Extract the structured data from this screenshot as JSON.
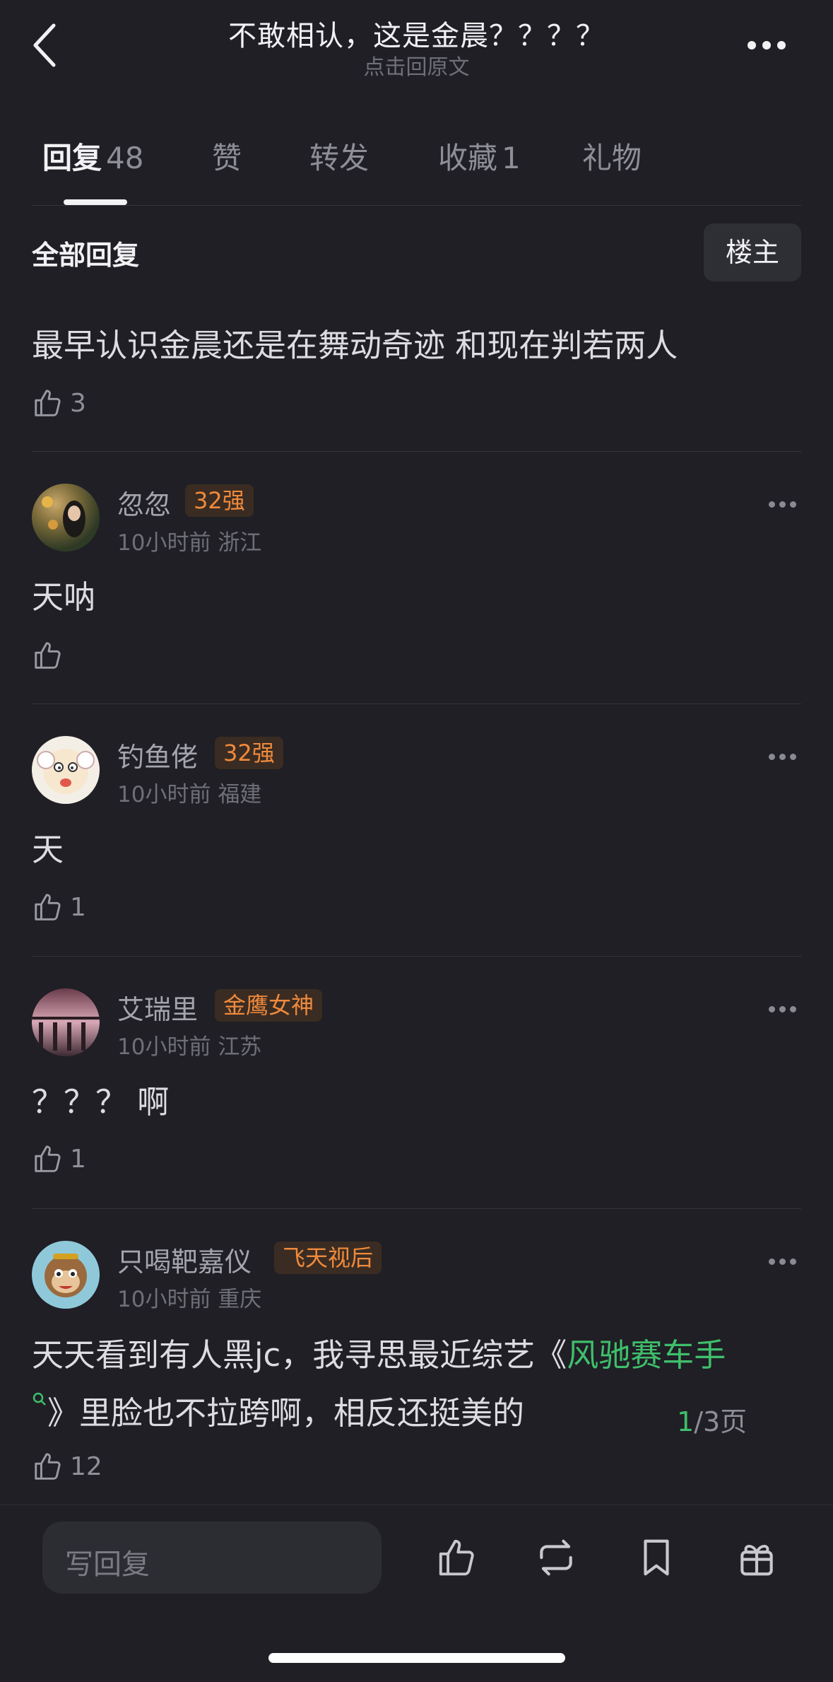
{
  "header": {
    "title": "不敢相认，这是金晨？？？？",
    "subtitle": "点击回原文"
  },
  "tabs": [
    {
      "label": "回复",
      "count": "48"
    },
    {
      "label": "赞",
      "count": ""
    },
    {
      "label": "转发",
      "count": ""
    },
    {
      "label": "收藏",
      "count": "1"
    },
    {
      "label": "礼物",
      "count": ""
    }
  ],
  "filter": {
    "all_label": "全部回复",
    "owner_button": "楼主"
  },
  "top_reply": {
    "text": "最早认识金晨还是在舞动奇迹 和现在判若两人",
    "likes": "3"
  },
  "comments": [
    {
      "name": "忽忽",
      "badge": "32强",
      "time": "10小时前",
      "location": "浙江",
      "text": "天呐",
      "likes": ""
    },
    {
      "name": "钓鱼佬",
      "badge": "32强",
      "time": "10小时前",
      "location": "福建",
      "text": "天",
      "likes": "1"
    },
    {
      "name": "艾瑞里",
      "badge": "金鹰女神",
      "time": "10小时前",
      "location": "江苏",
      "text": "？？？ 啊",
      "likes": "1"
    },
    {
      "name": "只喝靶嘉仪",
      "badge": "飞天视后",
      "time": "10小时前",
      "location": "重庆",
      "text_before": "天天看到有人黑jc，我寻思最近综艺《",
      "link": "风驰赛车手",
      "text_line2": "》里脸也不拉跨啊，相反还挺美的",
      "likes": "12"
    }
  ],
  "pagination": {
    "current": "1",
    "rest": "/3页"
  },
  "bottom_bar": {
    "reply_placeholder": "写回复"
  },
  "colors": {
    "background": "#1f1f25",
    "badge_text": "#f08a3c",
    "link": "#3fbf6b"
  },
  "icons": [
    "back-icon",
    "more-icon",
    "thumb-up-icon",
    "search-icon",
    "repost-icon",
    "bookmark-icon",
    "gift-icon"
  ]
}
